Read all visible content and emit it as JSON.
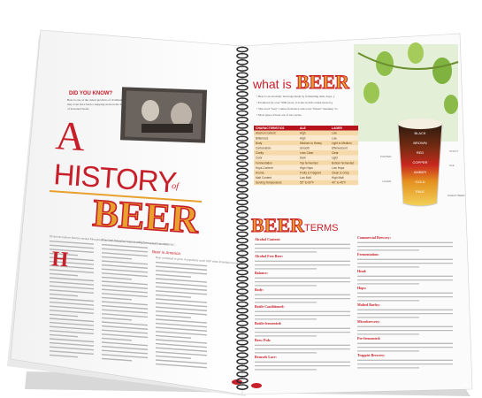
{
  "left_page": {
    "did_you_know_title": "DID YOU KNOW?",
    "did_you_know_text": "Beer is one of the oldest products of civilization, and may even have been a stepping stone in the invention of leavened bread.",
    "headline_a": "A",
    "headline_history": "HISTORY",
    "headline_of": "of",
    "headline_beer": "BEER",
    "sidebar_heading": "Beer in America",
    "body_col1": "Historians believe that the ancient Mesopotamians and Sumerians were brewing beer as early as 10,000 BC.",
    "body_col2": "Beer first arrived in America with Christopher Columbus.",
    "body_col3": "Beer continued to grow in popularity until 1920 when Prohibition took effect."
  },
  "right_page": {
    "what_is": "what is",
    "what_is_beer": "BEER",
    "intro_bullets": [
      "Beer is an alcoholic beverage made by fermenting malt, hops, yeast and water.",
      "Produced for over 7000 years, it is the world's oldest known grain beverage.",
      "The word \"beer\" comes from the Latin word \"bibere\" meaning \"to consume.\"",
      "Most types of beer are of two styles."
    ],
    "table_headers": [
      "CHARACTERISTICS",
      "ALE",
      "LAGER"
    ],
    "table_rows": [
      [
        "Alcohol Content",
        "High",
        "Low"
      ],
      [
        "Bitterness",
        "High",
        "Low"
      ],
      [
        "Body",
        "Medium to Heavy",
        "Light to Medium"
      ],
      [
        "Carbonation",
        "Smooth",
        "Effervescent"
      ],
      [
        "Clarity",
        "Less Clear",
        "Clear"
      ],
      [
        "Color",
        "Dark",
        "Light"
      ],
      [
        "Fermentation",
        "Top fermented",
        "Bottom fermented"
      ],
      [
        "Hops Content",
        "High Hops",
        "Low Hops"
      ],
      [
        "Aroma",
        "Fruity & Fragrant",
        "Clean & Crisp"
      ],
      [
        "Malt Content",
        "Low Malt",
        "High Malt"
      ],
      [
        "Serving Temperature",
        "55° to 60°F",
        "40° to 45°F"
      ]
    ],
    "glass_labels": [
      "BLACK",
      "BROWN",
      "RED",
      "COPPER",
      "AMBER",
      "GOLD",
      "PALE"
    ],
    "terms_word_beer": "BEER",
    "terms_word": "TERMS",
    "terms_col1": [
      "Alcohol Content:",
      "Alcohol Free Beer:",
      "Balance:",
      "Body:",
      "Bottle Conditioned:",
      "Bottle-fermented:",
      "Brew Pub:",
      "Brussels Lace:"
    ],
    "terms_col2": [
      "Commercial Brewery:",
      "Fermentation:",
      "Head:",
      "Hops:",
      "Malted Barley:",
      "Microbrewery:",
      "Pre-fermented:",
      "Trappist Brewery:"
    ]
  },
  "colors": {
    "accent_red": "#c8202a",
    "beer_orange": "#e8a12c",
    "table_header": "#b6131c"
  }
}
